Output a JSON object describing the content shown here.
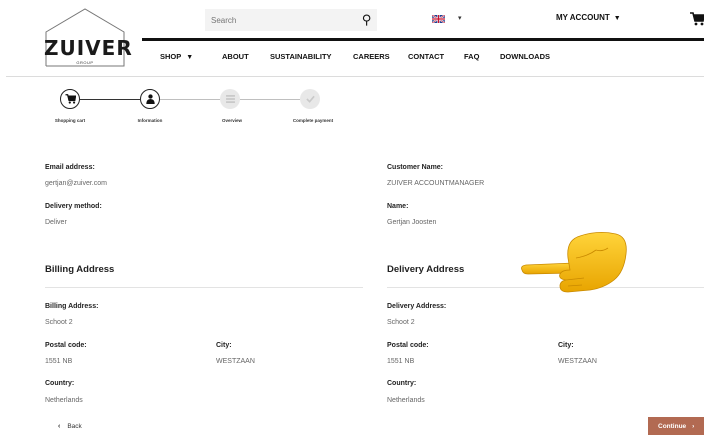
{
  "brand": {
    "name": "ZUIVER",
    "tagline": "GROUP"
  },
  "search": {
    "placeholder": "Search",
    "icon": "search-icon"
  },
  "language": {
    "icon": "uk-flag-icon",
    "caret": "▾"
  },
  "account": {
    "label": "MY ACCOUNT",
    "caret": "▼",
    "cart_icon": "shopping-cart-icon"
  },
  "nav": {
    "items": [
      {
        "label": "SHOP",
        "caret": "▼"
      },
      {
        "label": "ABOUT"
      },
      {
        "label": "SUSTAINABILITY"
      },
      {
        "label": "CAREERS"
      },
      {
        "label": "CONTACT"
      },
      {
        "label": "FAQ"
      },
      {
        "label": "DOWNLOADS"
      }
    ]
  },
  "steps": [
    {
      "label": "Shopping cart",
      "icon": "cart-icon",
      "state": "done"
    },
    {
      "label": "Information",
      "icon": "person-icon",
      "state": "active"
    },
    {
      "label": "Overview",
      "icon": "list-icon",
      "state": "inactive"
    },
    {
      "label": "Complete payment",
      "icon": "check-icon",
      "state": "inactive"
    }
  ],
  "customer": {
    "email_label": "Email address:",
    "email": "gertjan@zuiver.com",
    "customer_name_label": "Customer Name:",
    "customer_name": "ZUIVER ACCOUNTMANAGER",
    "delivery_method_label": "Delivery method:",
    "delivery_method": "Deliver",
    "name_label": "Name:",
    "name": "Gertjan Joosten"
  },
  "billing": {
    "title": "Billing Address",
    "address_label": "Billing Address:",
    "address": "Schoot 2",
    "postal_label": "Postal code:",
    "postal": "1551 NB",
    "city_label": "City:",
    "city": "WESTZAAN",
    "country_label": "Country:",
    "country": "Netherlands"
  },
  "delivery": {
    "title": "Delivery Address",
    "address_label": "Delivery Address:",
    "address": "Schoot 2",
    "postal_label": "Postal code:",
    "postal": "1551 NB",
    "city_label": "City:",
    "city": "WESTZAAN",
    "country_label": "Country:",
    "country": "Netherlands"
  },
  "footer": {
    "back_label": "Back",
    "back_chevron": "‹",
    "continue_label": "Continue",
    "continue_chevron": "›"
  },
  "overlay": {
    "icon": "pointing-hand-icon"
  },
  "colors": {
    "accent": "#b26a52",
    "text": "#222222",
    "muted": "#666666",
    "hand": "#f5b800"
  }
}
